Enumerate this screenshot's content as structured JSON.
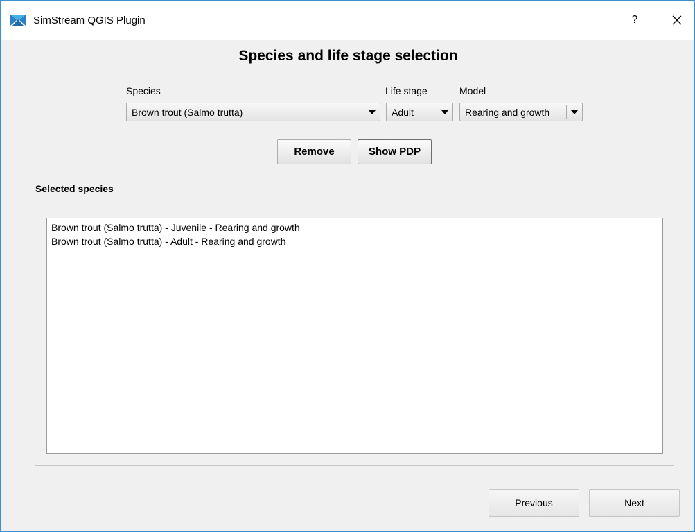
{
  "window": {
    "title": "SimStream QGIS Plugin",
    "help": "?"
  },
  "page": {
    "heading": "Species and life stage selection"
  },
  "species": {
    "label": "Species",
    "value": "Brown trout (Salmo trutta)"
  },
  "life_stage": {
    "label": "Life stage",
    "value": "Adult"
  },
  "model": {
    "label": "Model",
    "value": "Rearing and growth"
  },
  "actions": {
    "remove": "Remove",
    "show_pdp": "Show PDP"
  },
  "selected": {
    "label": "Selected species",
    "items": [
      "Brown trout (Salmo trutta) - Juvenile - Rearing and growth",
      "Brown trout (Salmo trutta) - Adult - Rearing and growth"
    ]
  },
  "nav": {
    "previous": "Previous",
    "next": "Next"
  },
  "colors": {
    "accent": "#3d8fd1",
    "icon_blue": "#2f7fc4",
    "icon_light": "#45b0e6"
  },
  "icons": {
    "app": "simstream-logo-icon",
    "close": "close-icon",
    "dropdown": "chevron-down-icon"
  }
}
